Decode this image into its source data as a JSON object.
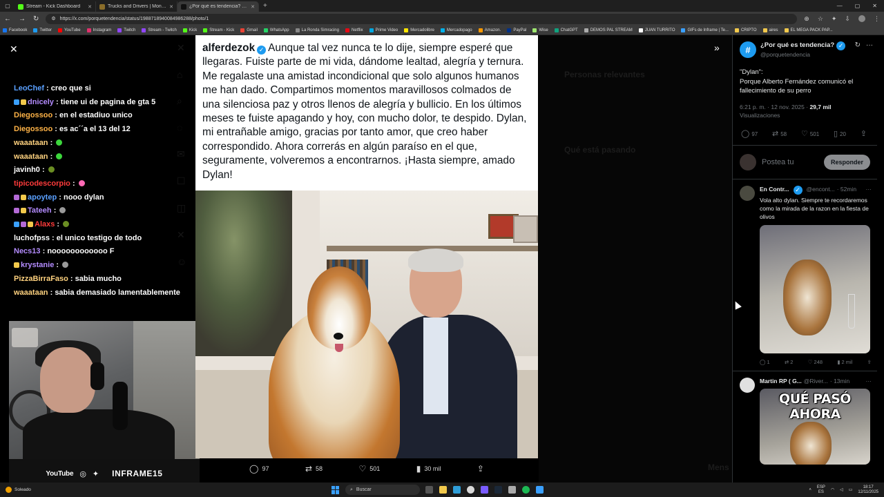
{
  "browser": {
    "tabs": [
      {
        "title": "Stream - Kick Dashboard",
        "color": "#53fc18",
        "active": false
      },
      {
        "title": "Trucks and Drivers | Monster Jam",
        "color": "#8a6d2a",
        "active": false
      },
      {
        "title": "¿Por qué es tendencia? en X: \"D...",
        "color": "#111111",
        "active": true
      }
    ],
    "url": "https://x.com/porquetendencia/status/1988718940084986288/photo/1",
    "bookmarks": [
      {
        "label": "Facebook",
        "color": "#1877f2"
      },
      {
        "label": "Twitter",
        "color": "#1d9bf0"
      },
      {
        "label": "YouTube",
        "color": "#ff0000"
      },
      {
        "label": "Instagram",
        "color": "#e1306c"
      },
      {
        "label": "Twitch",
        "color": "#9146ff"
      },
      {
        "label": "Stream - Twitch",
        "color": "#9146ff"
      },
      {
        "label": "Kick",
        "color": "#53fc18"
      },
      {
        "label": "Stream - Kick",
        "color": "#53fc18"
      },
      {
        "label": "Gmail",
        "color": "#ea4335"
      },
      {
        "label": "WhatsApp",
        "color": "#25d366"
      },
      {
        "label": "La Ronda Simracing",
        "color": "#888888"
      },
      {
        "label": "Netflix",
        "color": "#e50914"
      },
      {
        "label": "Prime Video",
        "color": "#00a8e1"
      },
      {
        "label": "Mercadolibre",
        "color": "#ffe600"
      },
      {
        "label": "Mercadopago",
        "color": "#00b1ea"
      },
      {
        "label": "Amazon.",
        "color": "#ff9900"
      },
      {
        "label": "PayPal",
        "color": "#003087"
      },
      {
        "label": "Wise",
        "color": "#9fe870"
      },
      {
        "label": "ChatGPT",
        "color": "#10a37f"
      },
      {
        "label": "DEMOS PAL STREAM",
        "color": "#aaaaaa"
      },
      {
        "label": "JUAN TURRITO",
        "color": "#ffffff"
      },
      {
        "label": "GIFs de Inframe | Te...",
        "color": "#3aa0ff"
      },
      {
        "label": "CRIPTO",
        "color": "#f2c94c"
      },
      {
        "label": "aires",
        "color": "#f2c94c"
      },
      {
        "label": "EL MEGA PACK PAP...",
        "color": "#f2c94c"
      }
    ]
  },
  "chat": [
    {
      "user": "LeoChef",
      "color": "#5aa0ff",
      "badges": [],
      "msg": "creo que si",
      "emote": null
    },
    {
      "user": "dnicely",
      "color": "#b48cff",
      "badges": [
        "#3aa0ff",
        "#f2c94c"
      ],
      "msg": "tiene ui de pagina de gta 5",
      "emote": null
    },
    {
      "user": "Diegossoo",
      "color": "#ffb347",
      "badges": [],
      "msg": "en el estadiuo unico",
      "emote": null
    },
    {
      "user": "Diegossoo",
      "color": "#ffb347",
      "badges": [],
      "msg": "es ac´´a el 13 del 12",
      "emote": null
    },
    {
      "user": "waaataan",
      "color": "#ffd27f",
      "badges": [],
      "msg": "",
      "emote": "#3cd63c"
    },
    {
      "user": "waaataan",
      "color": "#ffd27f",
      "badges": [],
      "msg": "",
      "emote": "#3cd63c"
    },
    {
      "user": "javinh0",
      "color": "#ffffff",
      "badges": [],
      "msg": "",
      "emote": "#6b8e23"
    },
    {
      "user": "tipicodescorpio",
      "color": "#ff3b3b",
      "badges": [],
      "msg": "",
      "emote": "#ff69b4"
    },
    {
      "user": "apoytep",
      "color": "#5aa0ff",
      "badges": [
        "#b46ad6",
        "#f2c94c"
      ],
      "msg": "nooo dylan",
      "emote": null
    },
    {
      "user": "Tateeh",
      "color": "#b48cff",
      "badges": [
        "#b46ad6",
        "#f2c94c"
      ],
      "msg": "",
      "emote": "#9a9a9a"
    },
    {
      "user": "Alaxs",
      "color": "#ff3b3b",
      "badges": [
        "#3aa0ff",
        "#b46ad6",
        "#f2c94c"
      ],
      "msg": "",
      "emote": "#6b8e23"
    },
    {
      "user": "luchofpss",
      "color": "#ffffff",
      "badges": [],
      "msg": "el unico testigo de todo",
      "emote": null
    },
    {
      "user": "Necs13",
      "color": "#b48cff",
      "badges": [],
      "msg": "noooooooooooo F",
      "emote": null
    },
    {
      "user": "krystanie",
      "color": "#b48cff",
      "badges": [
        "#f2c94c"
      ],
      "msg": "",
      "emote": "#9a9a9a"
    },
    {
      "user": "PizzaBirraFaso",
      "color": "#ffd27f",
      "badges": [],
      "msg": "sabia mucho",
      "emote": null
    },
    {
      "user": "waaataan",
      "color": "#ffd27f",
      "badges": [],
      "msg": "sabia demasiado lamentablemente",
      "emote": null
    }
  ],
  "stream": {
    "youtube": "YouTube",
    "handle": "INFRAME15"
  },
  "post": {
    "author": "alferdezok",
    "text": "Aunque tal vez nunca te lo dije, siempre esperé que llegaras. Fuiste parte de mi vida, dándome lealtad, alegría y ternura. Me regalaste una amistad incondicional que solo algunos humanos me han dado. Compartimos momentos maravillosos colmados de una silenciosa paz y otros llenos de alegría y bullicio. En los últimos meses te fuiste apagando y hoy, con mucho dolor, te despido. Dylan, mi entrañable amigo, gracias por tanto amor, que creo haber correspondido. Ahora correrás en algún paraíso en el que, seguramente, volveremos a encontrarnos. ¡Hasta siempre, amado Dylan!",
    "stats": {
      "replies": "97",
      "reposts": "58",
      "likes": "501",
      "views": "30 mil"
    }
  },
  "background": {
    "relevant": "Personas relevantes",
    "happening": "Qué está pasando",
    "bottom": "Mens"
  },
  "panel": {
    "name": "¿Por qué es tendencia?",
    "handle": "@porquetendencia",
    "body_line1": "\"Dylan\":",
    "body_line2": "Porque Alberto Fernández comunicó el fallecimiento de su perro",
    "time": "6:21 p. m. · 12 nov. 2025 · ",
    "views_count": "29,7 mil",
    "views_label": "Visualizaciones",
    "stats": {
      "replies": "97",
      "reposts": "58",
      "likes": "501",
      "bookmarks": "20"
    },
    "reply_placeholder": "Postea tu",
    "reply_button": "Responder",
    "replies": [
      {
        "name": "En Contr...",
        "handle": "@encont...",
        "time": "· 52min",
        "text": "Vola alto dylan. Siempre te recordaremos como la mirada de la razon en la fiesta de olivos",
        "stats": {
          "replies": "1",
          "reposts": "2",
          "likes": "248",
          "views": "2 mil"
        }
      },
      {
        "name": "Martin RP ( G...",
        "handle": "@River...",
        "time": "· 13min",
        "meme": "QUÉ PASÓ AHORA"
      }
    ]
  },
  "taskbar": {
    "weather": "Soleado",
    "search": "Buscar",
    "lang1": "ESP",
    "lang2": "ES",
    "time": "18:17",
    "date": "12/11/2025"
  }
}
